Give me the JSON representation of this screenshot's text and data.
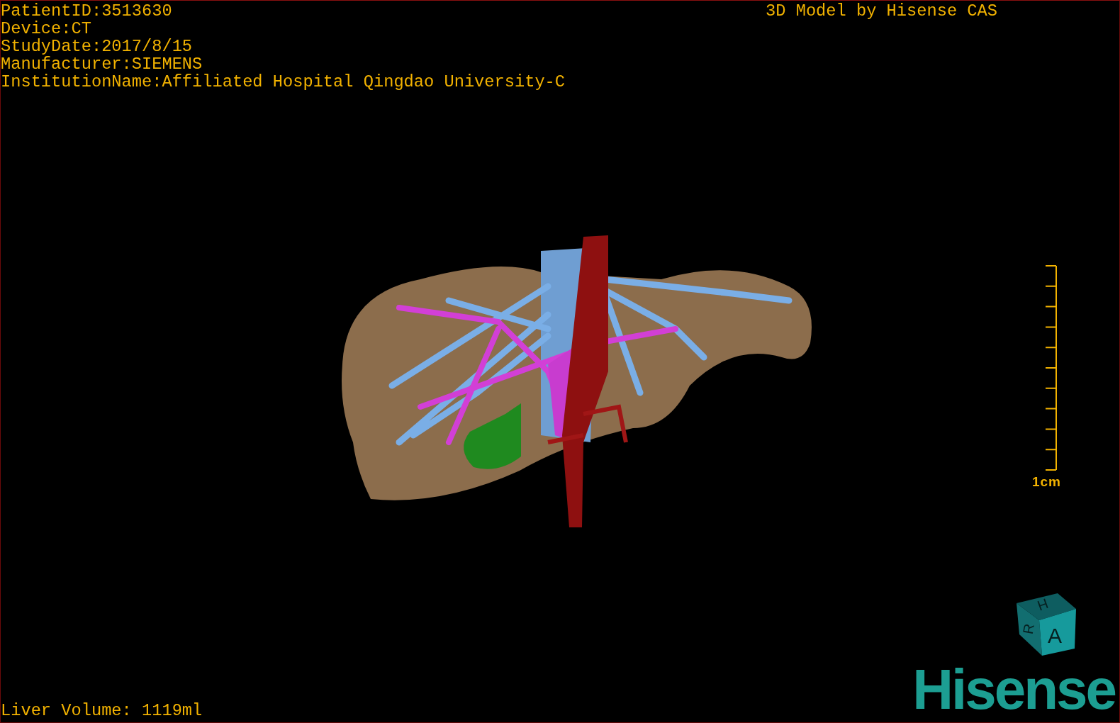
{
  "patient_info": [
    "PatientID:3513630",
    "Device:CT",
    "StudyDate:2017/8/15",
    "Manufacturer:SIEMENS",
    "InstitutionName:Affiliated Hospital Qingdao University-C"
  ],
  "model_credit": "3D Model by Hisense CAS",
  "scale_bar": {
    "label": "1cm"
  },
  "volume": "Liver Volume: 1119ml",
  "orientation_cube": {
    "labels": [
      "H",
      "R",
      "A"
    ]
  },
  "logo": "Hisense"
}
